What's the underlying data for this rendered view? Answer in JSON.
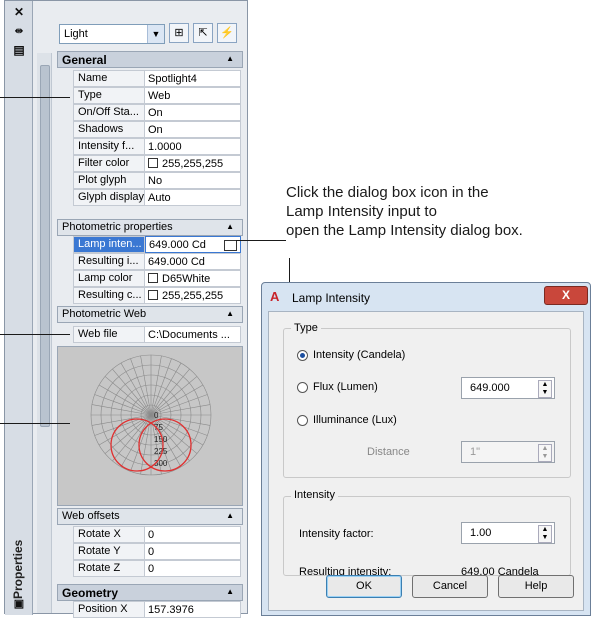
{
  "palette": {
    "title": "Properties",
    "combo_value": "Light",
    "sections": {
      "general": "General",
      "photometric": "Photometric properties",
      "photometric_web": "Photometric Web",
      "web_offsets": "Web offsets",
      "geometry": "Geometry"
    },
    "general_rows": [
      {
        "k": "Name",
        "v": "Spotlight4"
      },
      {
        "k": "Type",
        "v": "Web"
      },
      {
        "k": "On/Off Sta...",
        "v": "On"
      },
      {
        "k": "Shadows",
        "v": "On"
      },
      {
        "k": "Intensity f...",
        "v": "1.0000"
      },
      {
        "k": "Filter color",
        "v": "255,255,255"
      },
      {
        "k": "Plot glyph",
        "v": "No"
      },
      {
        "k": "Glyph display",
        "v": "Auto"
      }
    ],
    "photometric_rows": [
      {
        "k": "Lamp inten...",
        "v": "649.000 Cd"
      },
      {
        "k": "Resulting i...",
        "v": "649.000 Cd"
      },
      {
        "k": "Lamp color",
        "v": "D65White"
      },
      {
        "k": "Resulting c...",
        "v": "255,255,255"
      }
    ],
    "web_file_row": {
      "k": "Web file",
      "v": "C:\\Documents ..."
    },
    "web_preview_labels": [
      "0",
      "75",
      "150",
      "225",
      "300"
    ],
    "offset_rows": [
      {
        "k": "Rotate X",
        "v": "0"
      },
      {
        "k": "Rotate Y",
        "v": "0"
      },
      {
        "k": "Rotate Z",
        "v": "0"
      }
    ],
    "geometry_rows": [
      {
        "k": "Position X",
        "v": "157.3976"
      }
    ]
  },
  "callout": {
    "lines": [
      "Click the dialog box icon in the",
      "Lamp Intensity input to",
      "open the Lamp Intensity dialog box."
    ]
  },
  "dialog": {
    "title": "Lamp Intensity",
    "close": "X",
    "type_group": "Type",
    "radio_intensity": "Intensity (Candela)",
    "radio_flux": "Flux (Lumen)",
    "radio_illuminance": "Illuminance (Lux)",
    "flux_value": "649.000",
    "distance_label": "Distance",
    "distance_value": "1\"",
    "intensity_group": "Intensity",
    "intensity_factor_label": "Intensity factor:",
    "intensity_factor_value": "1.00",
    "resulting_label": "Resulting intensity:",
    "resulting_value": "649.00 Candela",
    "ok": "OK",
    "cancel": "Cancel",
    "help": "Help"
  },
  "colors": {
    "accent": "#3a78d3",
    "web_curve": "#e03030"
  }
}
